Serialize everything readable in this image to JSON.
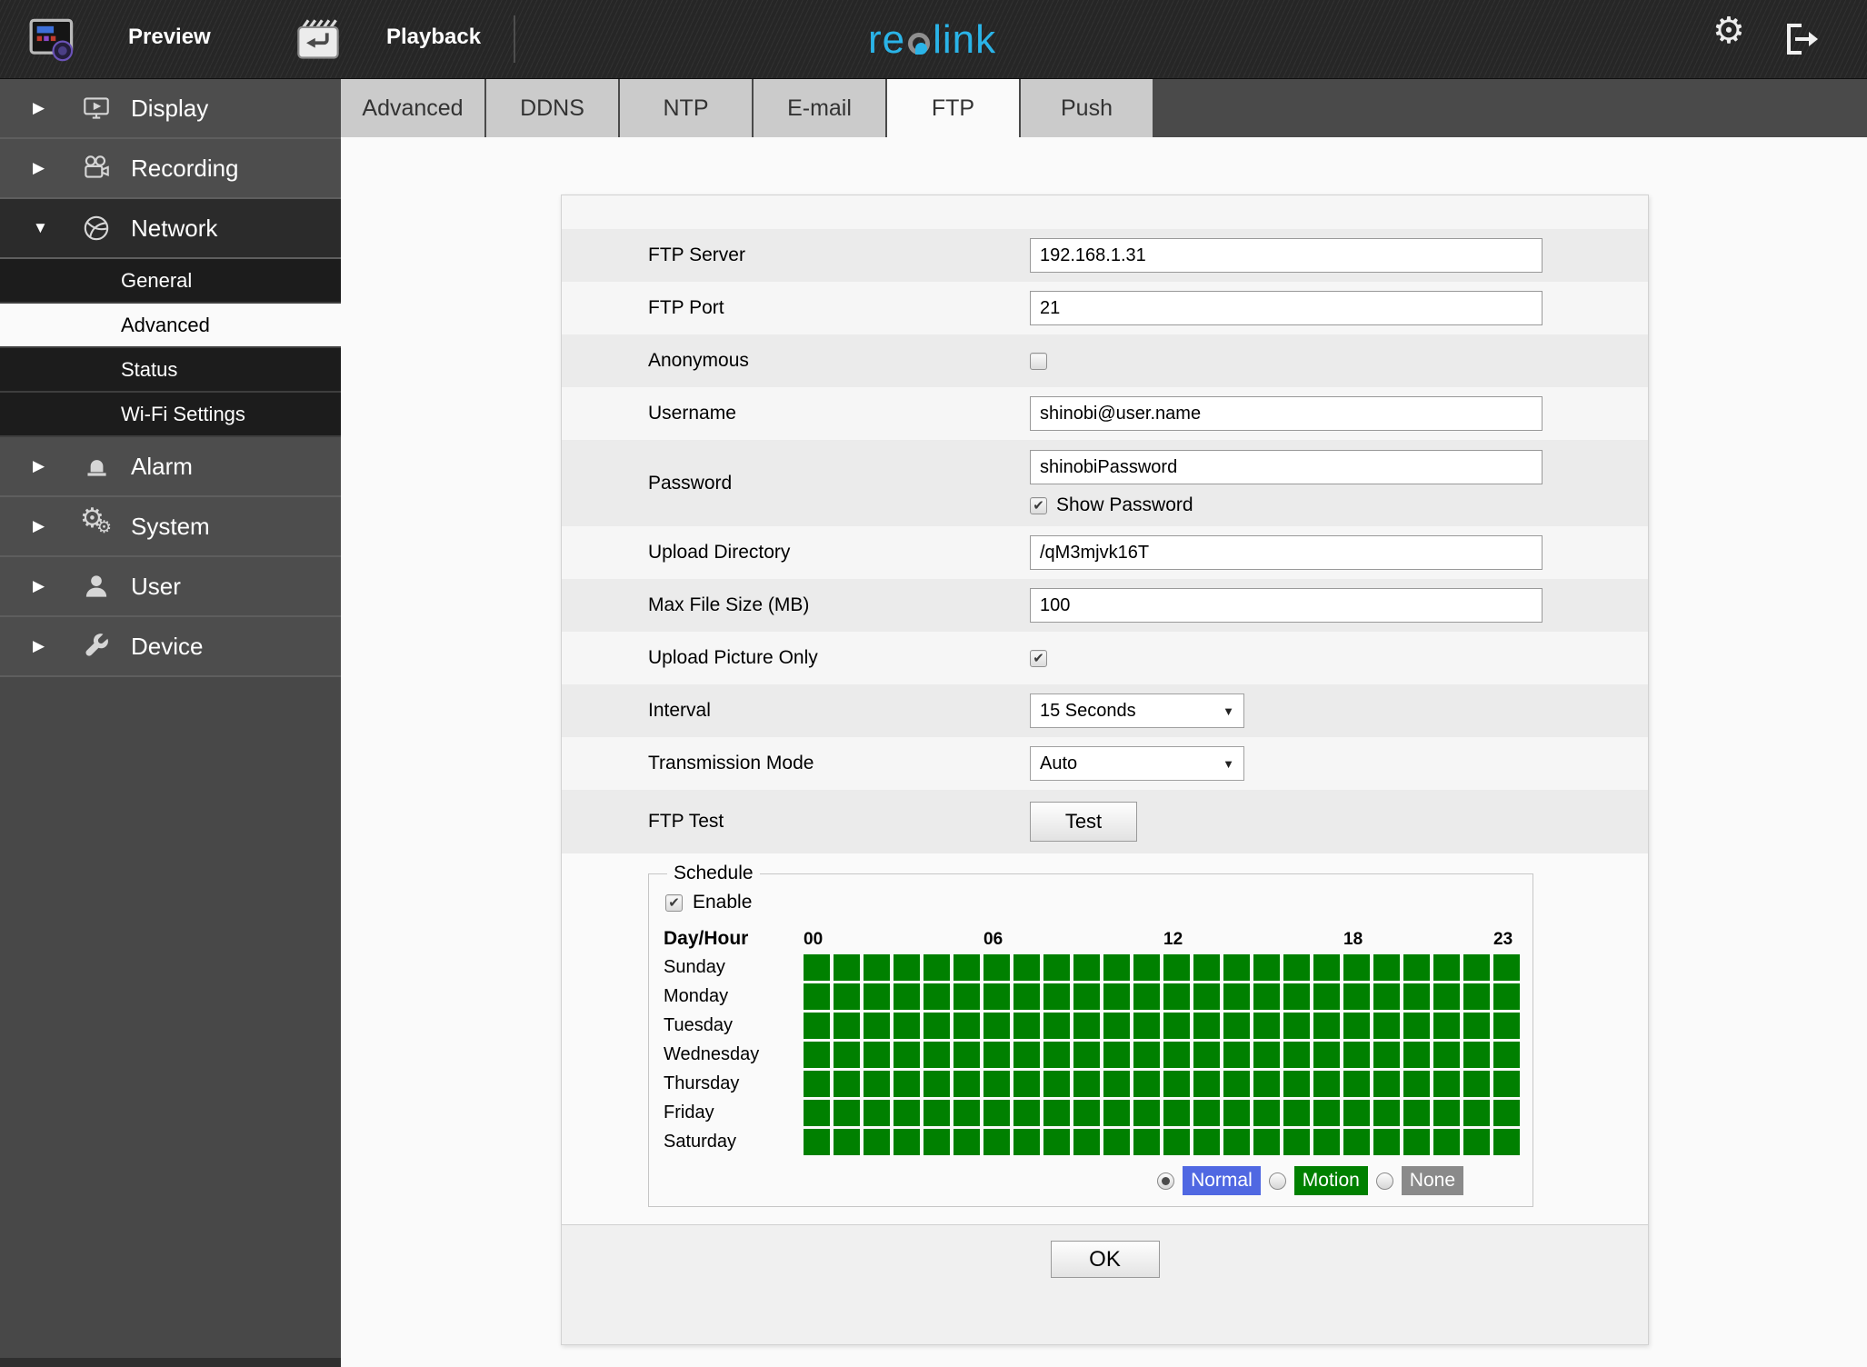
{
  "topbar": {
    "preview_label": "Preview",
    "playback_label": "Playback",
    "brand_pre": "re",
    "brand_post": "link",
    "brand_color": "#2ab4e8"
  },
  "glyphs": {
    "gear": "⚙",
    "arrow_right": "▶",
    "arrow_down": "▼",
    "select_arrow": "▼",
    "check": "✔"
  },
  "sidebar": {
    "display": {
      "label": "Display"
    },
    "recording": {
      "label": "Recording"
    },
    "network": {
      "label": "Network",
      "expanded": true,
      "children": [
        {
          "label": "General",
          "selected": false
        },
        {
          "label": "Advanced",
          "selected": true
        },
        {
          "label": "Status",
          "selected": false
        },
        {
          "label": "Wi-Fi Settings",
          "selected": false
        }
      ]
    },
    "alarm": {
      "label": "Alarm"
    },
    "system": {
      "label": "System"
    },
    "user": {
      "label": "User"
    },
    "device": {
      "label": "Device"
    }
  },
  "tabs": {
    "items": [
      {
        "label": "Advanced",
        "active": false
      },
      {
        "label": "DDNS",
        "active": false
      },
      {
        "label": "NTP",
        "active": false
      },
      {
        "label": "E-mail",
        "active": false
      },
      {
        "label": "FTP",
        "active": true
      },
      {
        "label": "Push",
        "active": false
      }
    ]
  },
  "form": {
    "ftp_server": {
      "label": "FTP Server",
      "value": "192.168.1.31"
    },
    "ftp_port": {
      "label": "FTP Port",
      "value": "21"
    },
    "anonymous": {
      "label": "Anonymous",
      "checked": false
    },
    "username": {
      "label": "Username",
      "value": "shinobi@user.name"
    },
    "password": {
      "label": "Password",
      "value": "shinobiPassword",
      "show_password_label": "Show Password",
      "show_password_checked": true
    },
    "upload_directory": {
      "label": "Upload Directory",
      "value": "/qM3mjvk16T"
    },
    "max_file_size": {
      "label": "Max File Size (MB)",
      "value": "100"
    },
    "upload_picture_only": {
      "label": "Upload Picture Only",
      "checked": true
    },
    "interval": {
      "label": "Interval",
      "value": "15 Seconds"
    },
    "transmission_mode": {
      "label": "Transmission Mode",
      "value": "Auto"
    },
    "ftp_test": {
      "label": "FTP Test",
      "button_label": "Test"
    }
  },
  "schedule": {
    "legend": "Schedule",
    "enable_label": "Enable",
    "enable_checked": true,
    "day_hour_label": "Day/Hour",
    "hour_labels": [
      "00",
      "06",
      "12",
      "18",
      "23"
    ],
    "days": [
      "Sunday",
      "Monday",
      "Tuesday",
      "Wednesday",
      "Thursday",
      "Friday",
      "Saturday"
    ],
    "slots_per_day": 24,
    "all_cells_state": "motion",
    "cell_color": "#008000",
    "modes": [
      {
        "label": "Normal",
        "color": "#5068e2",
        "selected": true
      },
      {
        "label": "Motion",
        "color": "#008000",
        "selected": false
      },
      {
        "label": "None",
        "color": "#8a8a8a",
        "selected": false
      }
    ]
  },
  "footer": {
    "ok_label": "OK"
  }
}
